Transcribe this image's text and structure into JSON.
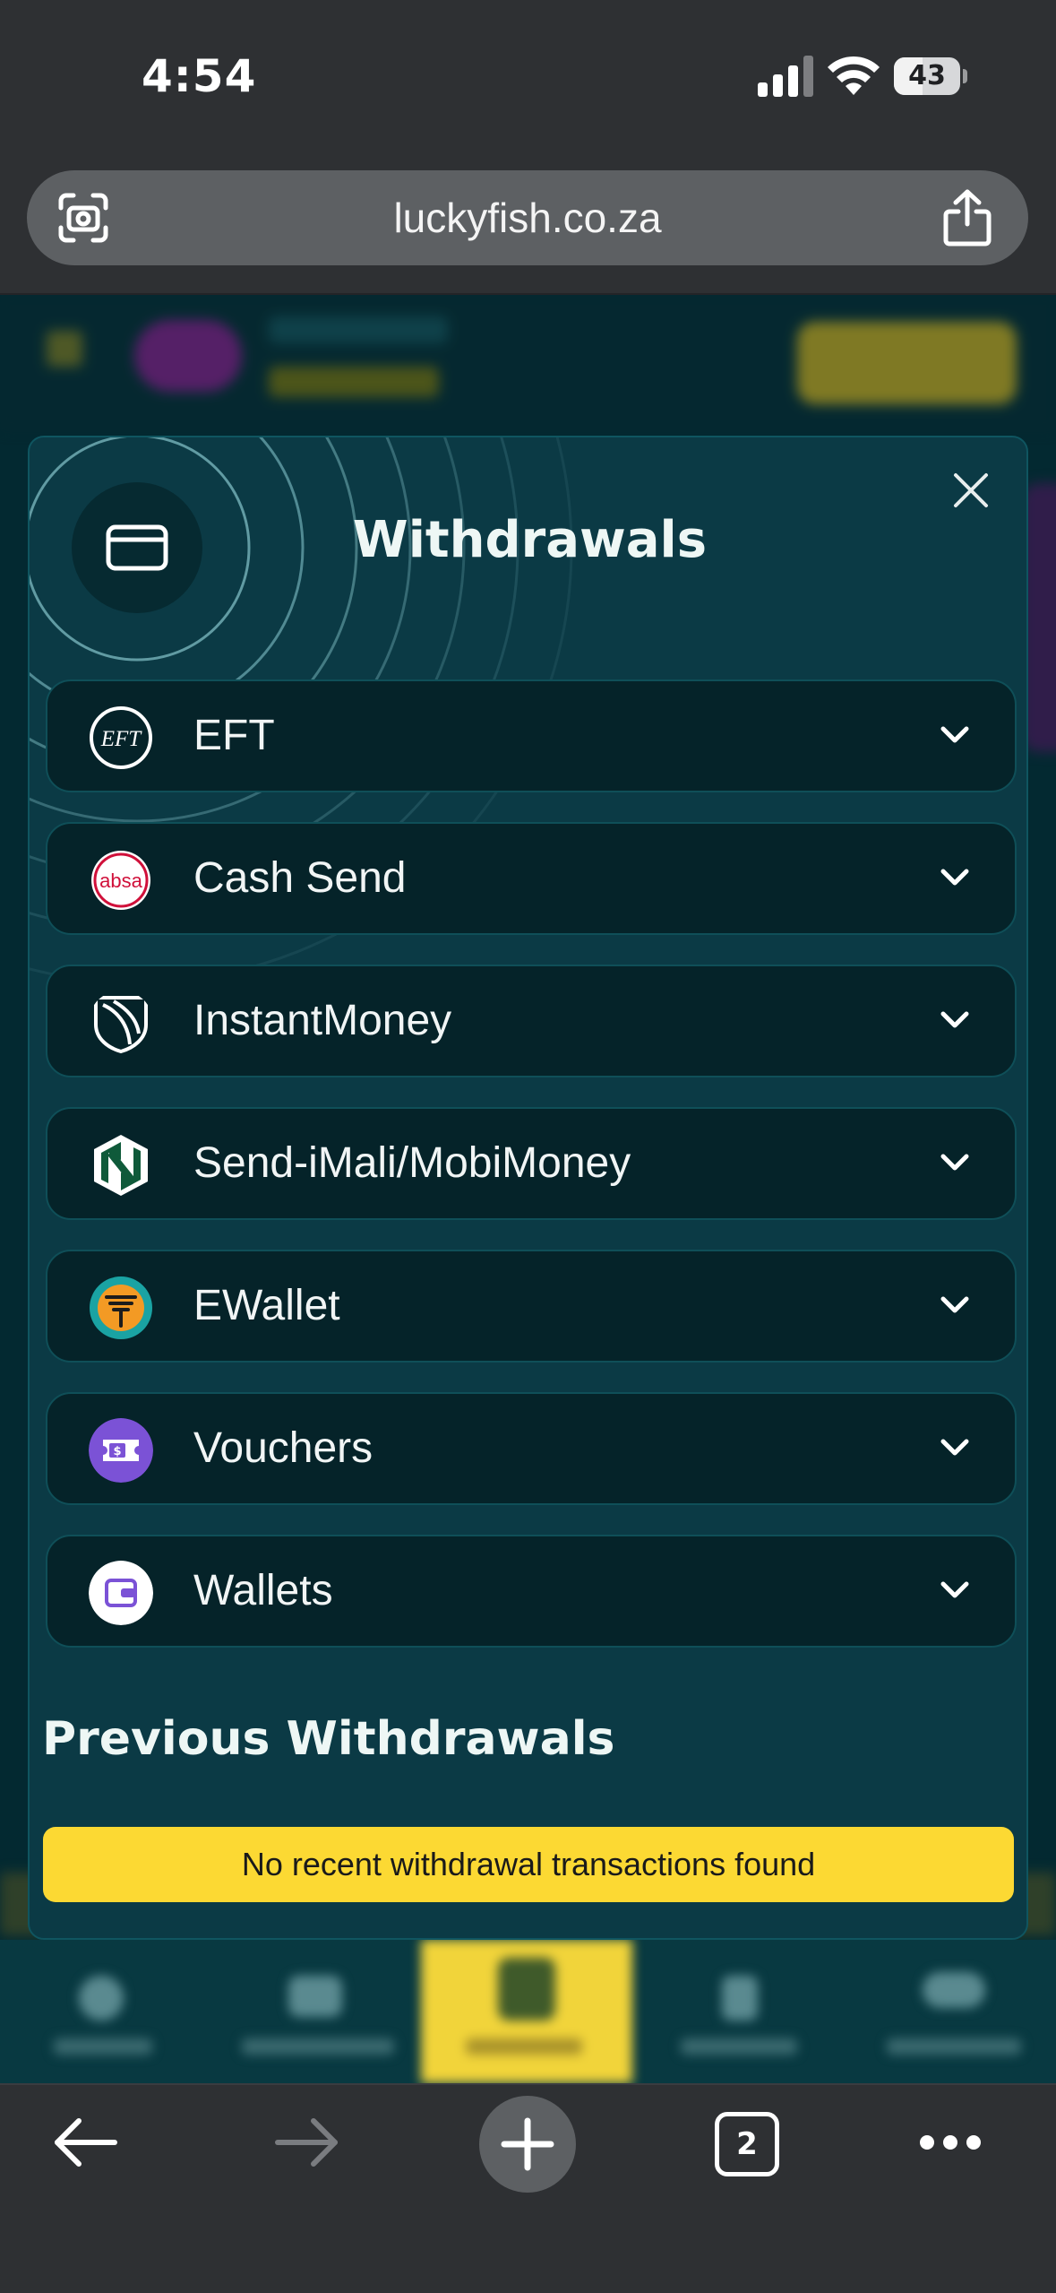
{
  "status_bar": {
    "time": "4:54",
    "battery_level": "43",
    "battery_fraction": 0.43
  },
  "browser": {
    "url": "luckyfish.co.za",
    "open_tabs": "2",
    "icons": {
      "lens": "camera-lens-icon",
      "share": "share-icon",
      "back": "arrow-left-icon",
      "forward": "arrow-right-icon",
      "new_tab": "plus-icon",
      "tabs": "tabs-icon",
      "more": "more-dots-icon"
    }
  },
  "modal": {
    "title": "Withdrawals",
    "header_icon": "credit-card-icon",
    "close_icon": "close-icon",
    "methods": [
      {
        "label": "EFT",
        "icon": "eft-logo-icon"
      },
      {
        "label": "Cash Send",
        "icon": "absa-logo-icon"
      },
      {
        "label": "InstantMoney",
        "icon": "standard-bank-logo-icon"
      },
      {
        "label": "Send-iMali/MobiMoney",
        "icon": "nedbank-logo-icon"
      },
      {
        "label": "EWallet",
        "icon": "fnb-logo-icon"
      },
      {
        "label": "Vouchers",
        "icon": "voucher-icon"
      },
      {
        "label": "Wallets",
        "icon": "wallet-icon"
      }
    ],
    "previous_title": "Previous Withdrawals",
    "empty_message": "No recent withdrawal transactions found"
  },
  "colors": {
    "accent_yellow": "#fcd933",
    "modal_bg": "#0b3a45",
    "row_bg": "#052329",
    "site_bg": "#073b44",
    "browser_chrome": "#2e3033"
  }
}
